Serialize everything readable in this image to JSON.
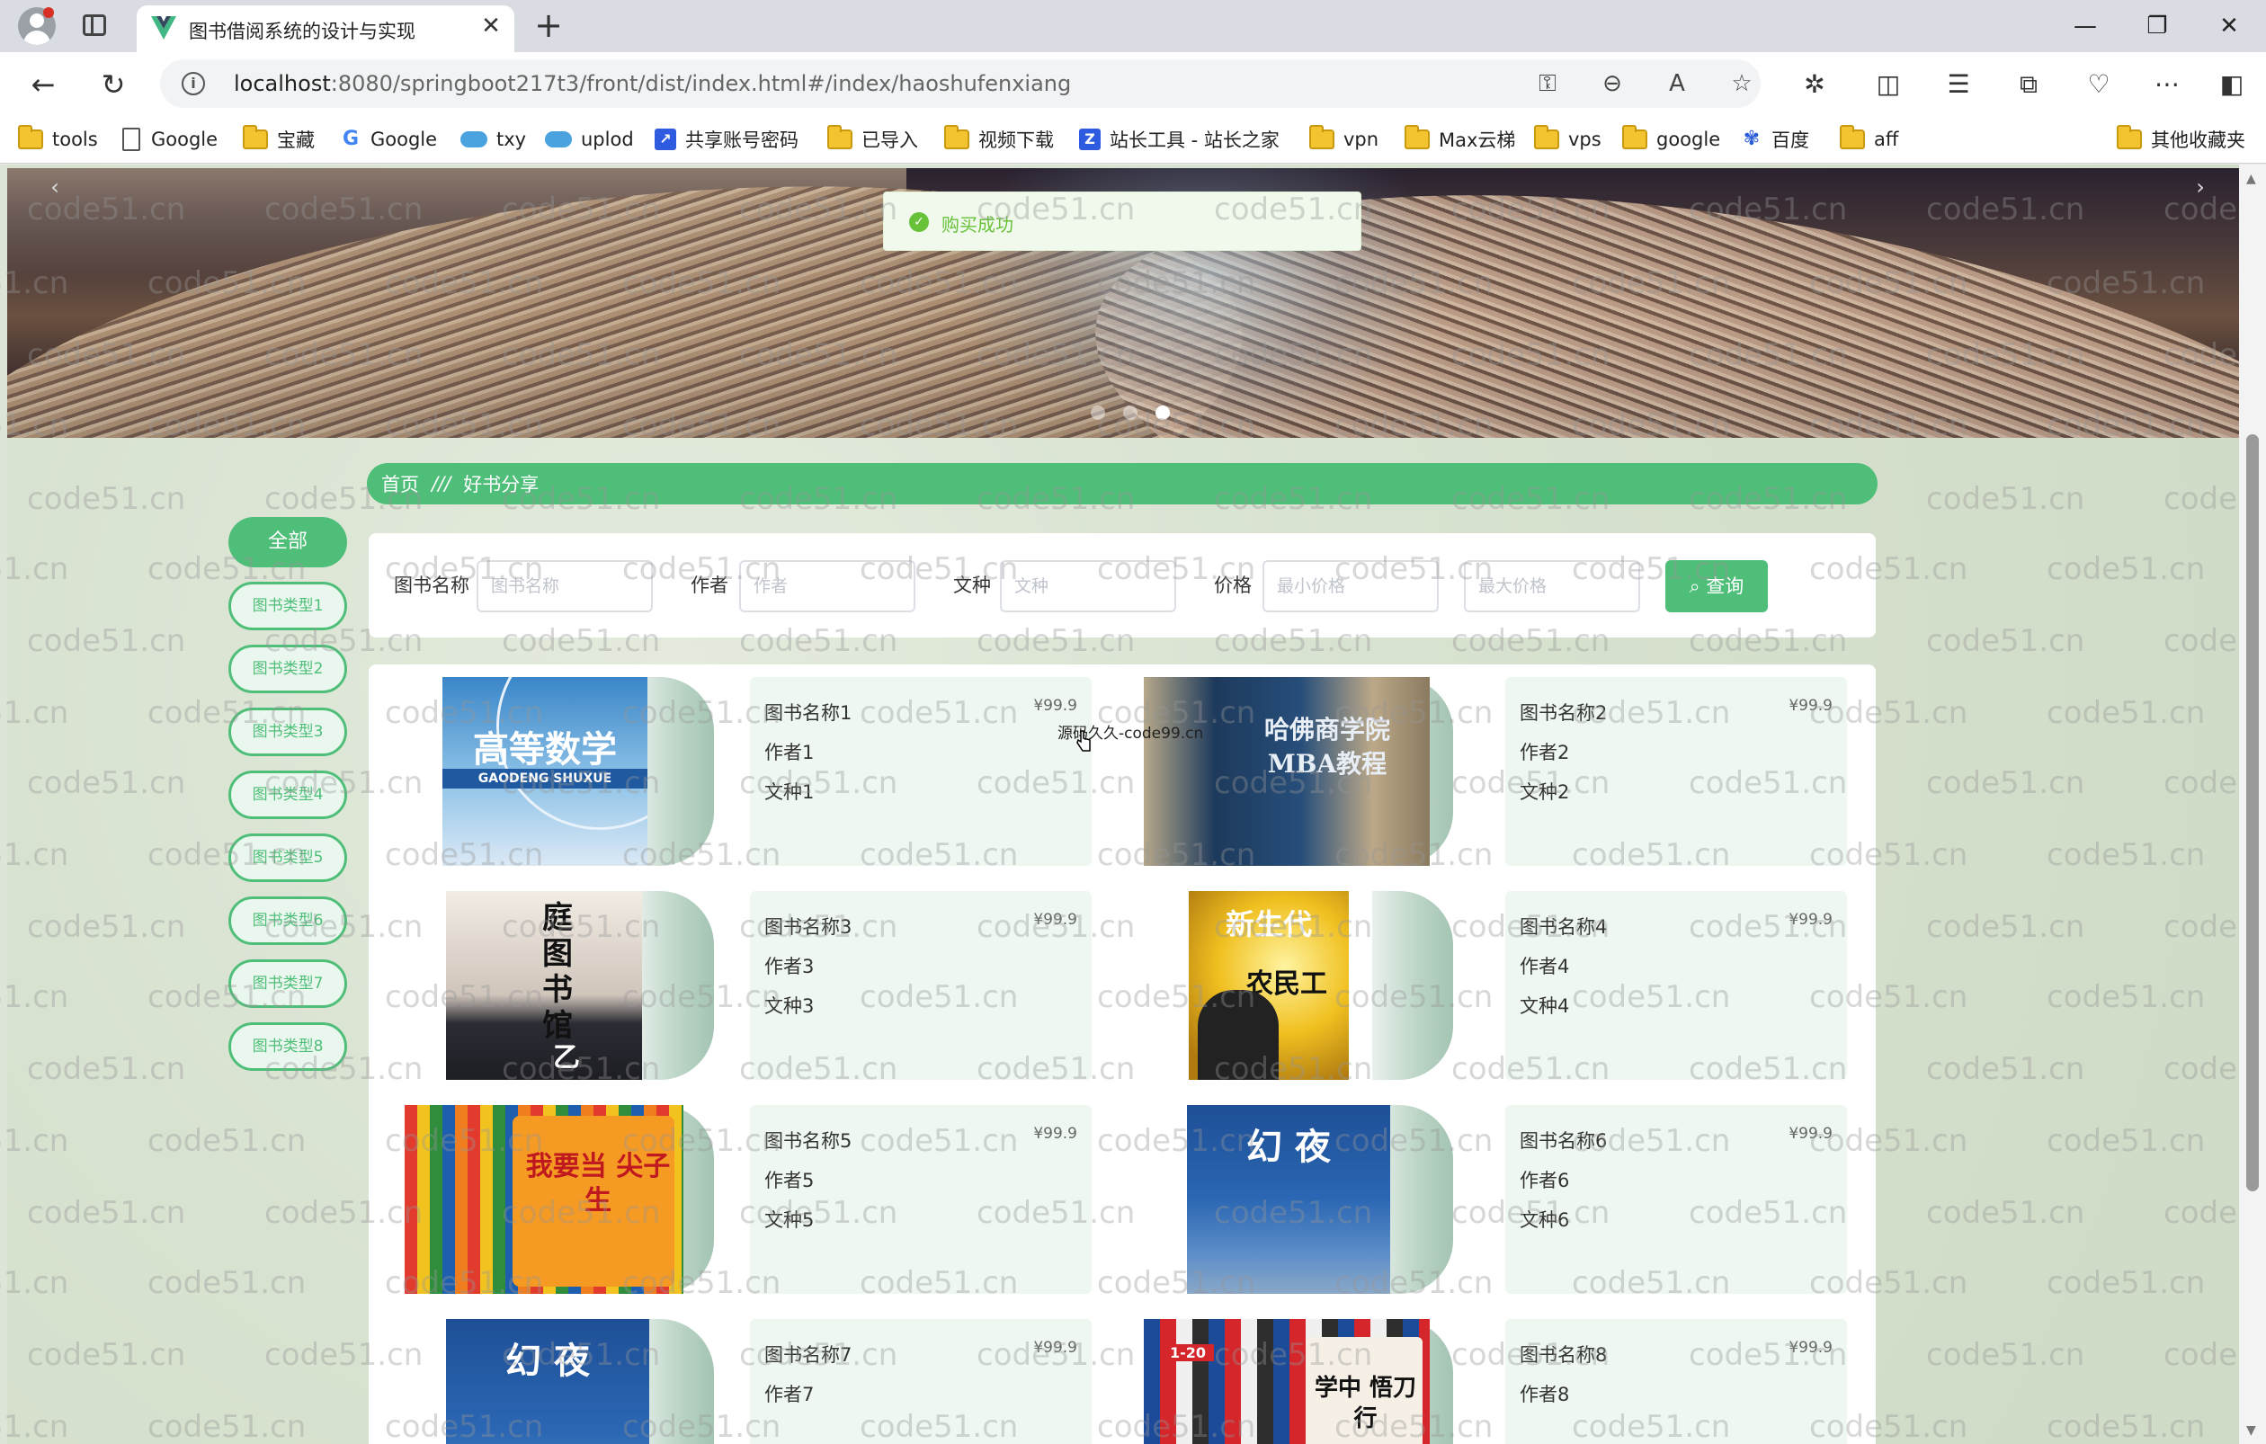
{
  "browser": {
    "tab_title": "图书借阅系统的设计与实现",
    "url_host": "localhost",
    "url_rest": ":8080/springboot217t3/front/dist/index.html#/index/haoshufenxiang",
    "bookmarks": [
      "tools",
      "Google",
      "宝藏",
      "Google",
      "txy",
      "uplod",
      "共享账号密码",
      "已导入",
      "视频下载",
      "站长工具 - 站长之家",
      "vpn",
      "Max云梯",
      "vps",
      "google",
      "百度",
      "aff"
    ],
    "other_bookmarks": "其他收藏夹"
  },
  "toast": {
    "message": "购买成功"
  },
  "breadcrumb": {
    "home": "首页",
    "separator": "///",
    "current": "好书分享"
  },
  "categories": {
    "all": "全部",
    "items": [
      "图书类型1",
      "图书类型2",
      "图书类型3",
      "图书类型4",
      "图书类型5",
      "图书类型6",
      "图书类型7",
      "图书类型8"
    ]
  },
  "search": {
    "name_label": "图书名称",
    "name_placeholder": "图书名称",
    "author_label": "作者",
    "author_placeholder": "作者",
    "lang_label": "文种",
    "lang_placeholder": "文种",
    "price_label": "价格",
    "min_placeholder": "最小价格",
    "max_placeholder": "最大价格",
    "button": "查询"
  },
  "books": [
    {
      "name": "图书名称1",
      "author": "作者1",
      "lang": "文种1",
      "price": "¥99.9",
      "cover_text": "高等数学",
      "cover_sub": "GAODENG SHUXUE"
    },
    {
      "name": "图书名称2",
      "author": "作者2",
      "lang": "文种2",
      "price": "¥99.9",
      "cover_text": "哈佛商学院 MBA教程",
      "cover_sub": ""
    },
    {
      "name": "图书名称3",
      "author": "作者3",
      "lang": "文种3",
      "price": "¥99.9",
      "cover_text": "庭图书馆",
      "cover_sub": "乙"
    },
    {
      "name": "图书名称4",
      "author": "作者4",
      "lang": "文种4",
      "price": "¥99.9",
      "cover_text": "新生代",
      "cover_sub": "农民工"
    },
    {
      "name": "图书名称5",
      "author": "作者5",
      "lang": "文种5",
      "price": "¥99.9",
      "cover_text": "我要当 尖子生",
      "cover_sub": ""
    },
    {
      "name": "图书名称6",
      "author": "作者6",
      "lang": "文种6",
      "price": "¥99.9",
      "cover_text": "幻 夜",
      "cover_sub": ""
    },
    {
      "name": "图书名称7",
      "author": "作者7",
      "lang": "",
      "price": "¥99.9",
      "cover_text": "幻 夜",
      "cover_sub": ""
    },
    {
      "name": "图书名称8",
      "author": "作者8",
      "lang": "",
      "price": "¥99.9",
      "cover_text": "学中 悟刀行",
      "cover_sub": "1-20"
    }
  ],
  "overlay": {
    "caption": "源码久久-code99.cn"
  },
  "watermark_text": "code51.cn",
  "colors": {
    "accent": "#4fbe79",
    "toast_green": "#67c23a",
    "card_bg": "#eef7f0"
  }
}
